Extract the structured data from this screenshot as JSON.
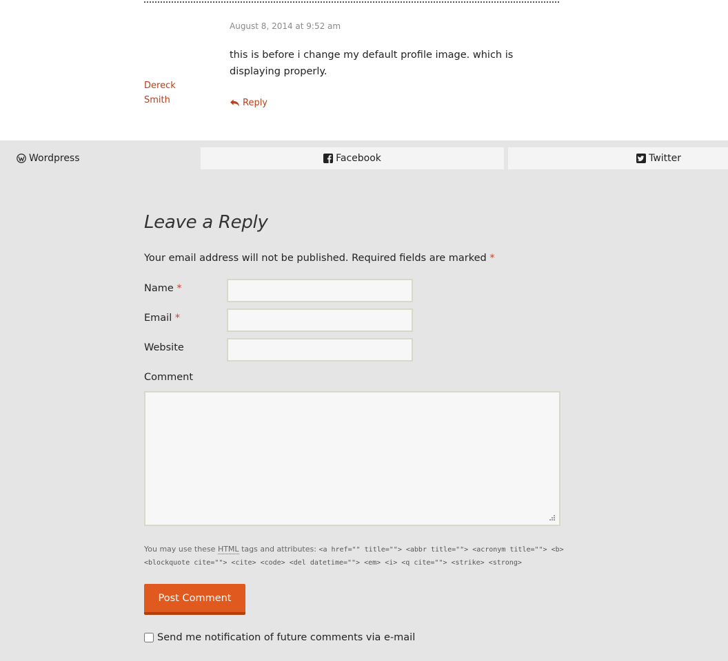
{
  "comment": {
    "date": "August 8, 2014 at 9:52 am",
    "text": "this is before i change my default profile image. which is displaying properly.",
    "author_first": "Dereck",
    "author_last": "Smith",
    "reply_label": "Reply",
    "reply_icon": "reply-arrow-icon"
  },
  "share": {
    "wordpress": {
      "label": "Wordpress",
      "icon": "wordpress-icon"
    },
    "facebook": {
      "label": "Facebook",
      "icon": "facebook-icon"
    },
    "twitter": {
      "label": "Twitter",
      "icon": "twitter-icon"
    }
  },
  "form": {
    "title": "Leave a Reply",
    "notes": "Your email address will not be published. Required fields are marked",
    "required_mark": "*",
    "name_label": "Name",
    "name_value": "",
    "email_label": "Email",
    "email_value": "",
    "website_label": "Website",
    "website_value": "",
    "comment_label": "Comment",
    "comment_value": "",
    "allowed_prefix": "You may use these",
    "allowed_abbr": "HTML",
    "allowed_suffix": "tags and attributes:",
    "allowed_tags": "<a href=\"\" title=\"\"> <abbr title=\"\"> <acronym title=\"\"> <b> <blockquote cite=\"\"> <cite> <code> <del datetime=\"\"> <em> <i> <q cite=\"\"> <strike> <strong>",
    "submit_label": "Post Comment",
    "subscribe_label": "Send me notification of future comments via e-mail",
    "subscribe_checked": false
  },
  "colors": {
    "accent": "#b8401a",
    "button": "#e05a1f",
    "required": "#d0402a",
    "page_bg": "#e5e5e5"
  }
}
